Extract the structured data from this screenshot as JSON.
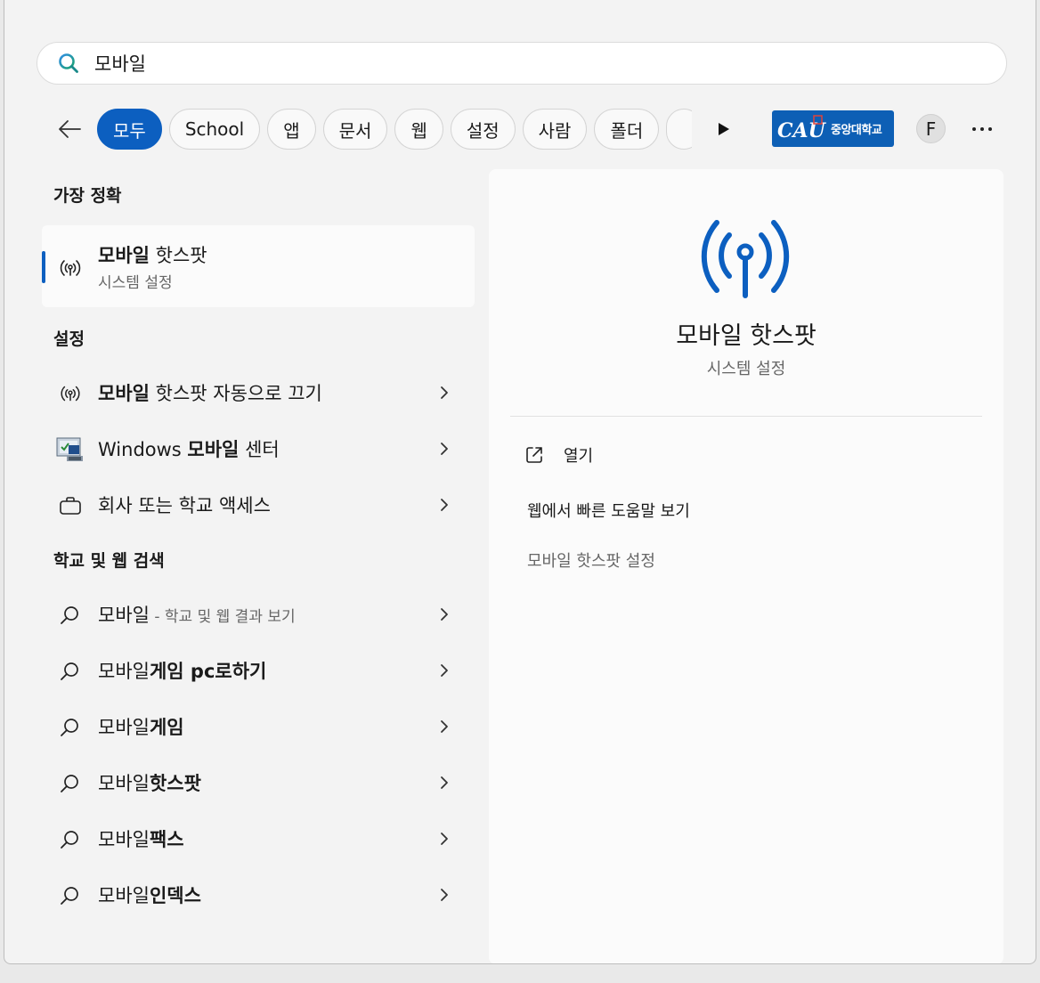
{
  "search": {
    "value": "모바일",
    "icon": "search-icon"
  },
  "filters": {
    "back_icon": "arrow-left-icon",
    "pills": [
      "모두",
      "School",
      "앱",
      "문서",
      "웹",
      "설정",
      "사람",
      "폴더",
      ""
    ],
    "active_index": 0,
    "next_icon": "play-icon",
    "org_logo": {
      "mark": "CAU",
      "name": "중앙대학교"
    },
    "avatar_initial": "F",
    "more_icon": "more-icon"
  },
  "best_match": {
    "heading": "가장 정확",
    "title_bold": "모바일",
    "title_rest": " 핫스팟",
    "subtitle": "시스템 설정",
    "icon": "hotspot-icon"
  },
  "settings": {
    "heading": "설정",
    "items": [
      {
        "bold": "모바일",
        "pre": "",
        "rest": " 핫스팟 자동으로 끄기",
        "icon": "hotspot-icon"
      },
      {
        "pre": "Windows ",
        "bold": "모바일",
        "rest": " 센터",
        "icon": "mobility-center-icon"
      },
      {
        "pre": "회사 또는 학교 액세스",
        "bold": "",
        "rest": "",
        "icon": "briefcase-icon"
      }
    ]
  },
  "web_search": {
    "heading": "학교 및 웹 검색",
    "items": [
      {
        "normal": "모바일",
        "bold": "",
        "note": " - 학교 및 웹 결과 보기"
      },
      {
        "normal": "모바일",
        "bold": "게임 pc로하기",
        "note": ""
      },
      {
        "normal": "모바일",
        "bold": "게임",
        "note": ""
      },
      {
        "normal": "모바일",
        "bold": "핫스팟",
        "note": ""
      },
      {
        "normal": "모바일",
        "bold": "팩스",
        "note": ""
      },
      {
        "normal": "모바일",
        "bold": "인덱스",
        "note": ""
      }
    ]
  },
  "detail": {
    "title": "모바일 핫스팟",
    "subtitle": "시스템 설정",
    "open_label": "열기",
    "web_help": "웹에서 빠른 도움말 보기",
    "related_setting": "모바일 핫스팟 설정",
    "icon": "hotspot-icon"
  },
  "colors": {
    "accent": "#0c5fc0",
    "logo_bg": "#0d5fb5",
    "panel": "#fbfbfb",
    "background": "#f3f3f3"
  }
}
